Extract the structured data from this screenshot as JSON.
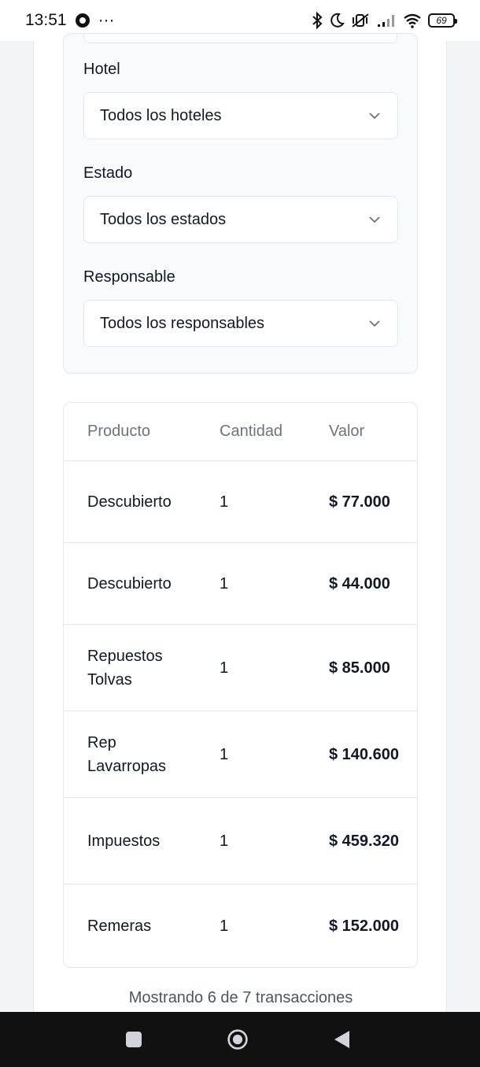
{
  "status_bar": {
    "time": "13:51",
    "notification_dots": "···",
    "battery": "69"
  },
  "filters": {
    "hotel": {
      "label": "Hotel",
      "value": "Todos los hoteles"
    },
    "estado": {
      "label": "Estado",
      "value": "Todos los estados"
    },
    "responsable": {
      "label": "Responsable",
      "value": "Todos los responsables"
    }
  },
  "table": {
    "headers": [
      "Producto",
      "Cantidad",
      "Valor"
    ],
    "rows": [
      {
        "producto": "Descubierto",
        "cantidad": "1",
        "valor": "$ 77.000"
      },
      {
        "producto": "Descubierto",
        "cantidad": "1",
        "valor": "$ 44.000"
      },
      {
        "producto": "Repuestos Tolvas",
        "cantidad": "1",
        "valor": "$ 85.000"
      },
      {
        "producto": "Rep Lavarropas",
        "cantidad": "1",
        "valor": "$ 140.600"
      },
      {
        "producto": "Impuestos",
        "cantidad": "1",
        "valor": "$ 459.320"
      },
      {
        "producto": "Remeras",
        "cantidad": "1",
        "valor": "$ 152.000"
      }
    ]
  },
  "footer": {
    "summary": "Mostrando 6 de 7 transacciones"
  },
  "colors": {
    "border": "#e5e7eb",
    "muted_text": "#6b7280",
    "nav_bar": "#111111"
  }
}
